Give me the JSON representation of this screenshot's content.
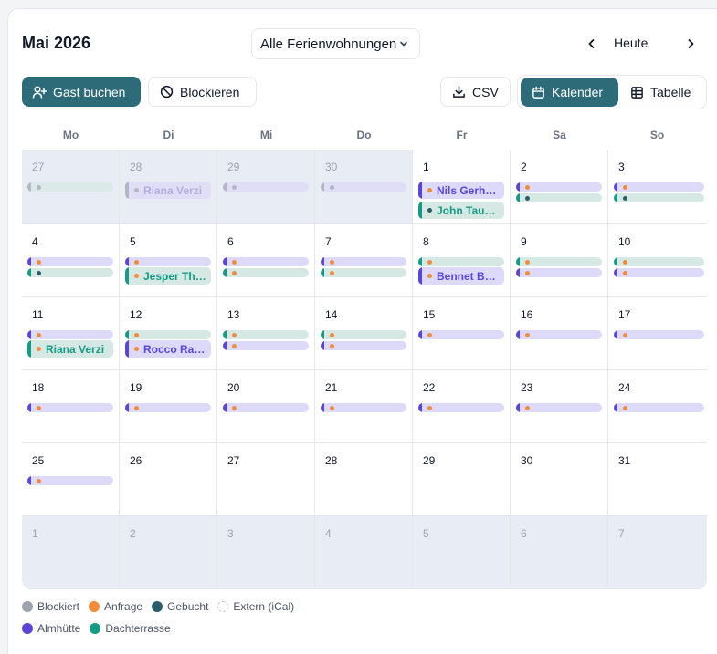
{
  "header": {
    "month_title": "Mai 2026",
    "property_select": "Alle Ferienwohnungen",
    "today_label": "Heute"
  },
  "toolbar": {
    "book_guest": "Gast buchen",
    "block": "Blockieren",
    "csv": "CSV",
    "view_calendar": "Kalender",
    "view_table": "Tabelle",
    "active_view": "Kalender"
  },
  "colors": {
    "brand": "#2d6b78",
    "almhuette": "#5b45d9",
    "dachterrasse": "#159a85",
    "blockiert": "#9ca3af",
    "anfrage": "#f28c3a",
    "gebucht": "#2c5d6b",
    "almhuette_bg": "#ddd9f8",
    "dachterrasse_bg": "#d6e8e3",
    "outside_bg": "#e8ecf5"
  },
  "weekdays": [
    "Mo",
    "Di",
    "Mi",
    "Do",
    "Fr",
    "Sa",
    "So"
  ],
  "weeks": [
    [
      {
        "day": "27",
        "outside": true,
        "events": [
          {
            "unit": "dach",
            "status": "blockiert"
          }
        ]
      },
      {
        "day": "28",
        "outside": true,
        "events": [
          {
            "unit": "alm",
            "status": "blockiert",
            "label": "Riana Verzi"
          }
        ]
      },
      {
        "day": "29",
        "outside": true,
        "events": [
          {
            "unit": "alm",
            "status": "blockiert"
          }
        ]
      },
      {
        "day": "30",
        "outside": true,
        "events": [
          {
            "unit": "alm",
            "status": "blockiert"
          }
        ]
      },
      {
        "day": "1",
        "outside": false,
        "events": [
          {
            "unit": "alm",
            "status": "anfrage",
            "label": "Nils Gerhardt"
          },
          {
            "unit": "dach",
            "status": "gebucht",
            "label": "John Tausend"
          }
        ]
      },
      {
        "day": "2",
        "outside": false,
        "events": [
          {
            "unit": "alm",
            "status": "anfrage"
          },
          {
            "unit": "dach",
            "status": "gebucht"
          }
        ]
      },
      {
        "day": "3",
        "outside": false,
        "events": [
          {
            "unit": "alm",
            "status": "anfrage"
          },
          {
            "unit": "dach",
            "status": "gebucht"
          }
        ]
      }
    ],
    [
      {
        "day": "4",
        "outside": false,
        "events": [
          {
            "unit": "alm",
            "status": "anfrage"
          },
          {
            "unit": "dach",
            "status": "gebucht"
          }
        ]
      },
      {
        "day": "5",
        "outside": false,
        "events": [
          {
            "unit": "alm",
            "status": "anfrage"
          },
          {
            "unit": "dach",
            "status": "anfrage",
            "label": "Jesper Thomsen"
          }
        ]
      },
      {
        "day": "6",
        "outside": false,
        "events": [
          {
            "unit": "alm",
            "status": "anfrage"
          },
          {
            "unit": "dach",
            "status": "anfrage"
          }
        ]
      },
      {
        "day": "7",
        "outside": false,
        "events": [
          {
            "unit": "alm",
            "status": "anfrage"
          },
          {
            "unit": "dach",
            "status": "anfrage"
          }
        ]
      },
      {
        "day": "8",
        "outside": false,
        "events": [
          {
            "unit": "dach",
            "status": "anfrage"
          },
          {
            "unit": "alm",
            "status": "anfrage",
            "label": "Bennet Bauer"
          }
        ]
      },
      {
        "day": "9",
        "outside": false,
        "events": [
          {
            "unit": "dach",
            "status": "anfrage"
          },
          {
            "unit": "alm",
            "status": "anfrage"
          }
        ]
      },
      {
        "day": "10",
        "outside": false,
        "events": [
          {
            "unit": "dach",
            "status": "anfrage"
          },
          {
            "unit": "alm",
            "status": "anfrage"
          }
        ]
      }
    ],
    [
      {
        "day": "11",
        "outside": false,
        "events": [
          {
            "unit": "alm",
            "status": "anfrage"
          },
          {
            "unit": "dach",
            "status": "anfrage",
            "label": "Riana Verzi"
          }
        ]
      },
      {
        "day": "12",
        "outside": false,
        "events": [
          {
            "unit": "dach",
            "status": "anfrage"
          },
          {
            "unit": "alm",
            "status": "anfrage",
            "label": "Rocco Rausch"
          }
        ]
      },
      {
        "day": "13",
        "outside": false,
        "events": [
          {
            "unit": "dach",
            "status": "anfrage"
          },
          {
            "unit": "alm",
            "status": "anfrage"
          }
        ]
      },
      {
        "day": "14",
        "outside": false,
        "events": [
          {
            "unit": "dach",
            "status": "anfrage"
          },
          {
            "unit": "alm",
            "status": "anfrage"
          }
        ]
      },
      {
        "day": "15",
        "outside": false,
        "events": [
          {
            "unit": "alm",
            "status": "anfrage"
          }
        ]
      },
      {
        "day": "16",
        "outside": false,
        "events": [
          {
            "unit": "alm",
            "status": "anfrage"
          }
        ]
      },
      {
        "day": "17",
        "outside": false,
        "events": [
          {
            "unit": "alm",
            "status": "anfrage"
          }
        ]
      }
    ],
    [
      {
        "day": "18",
        "outside": false,
        "events": [
          {
            "unit": "alm",
            "status": "anfrage"
          }
        ]
      },
      {
        "day": "19",
        "outside": false,
        "events": [
          {
            "unit": "alm",
            "status": "anfrage"
          }
        ]
      },
      {
        "day": "20",
        "outside": false,
        "events": [
          {
            "unit": "alm",
            "status": "anfrage"
          }
        ]
      },
      {
        "day": "21",
        "outside": false,
        "events": [
          {
            "unit": "alm",
            "status": "anfrage"
          }
        ]
      },
      {
        "day": "22",
        "outside": false,
        "events": [
          {
            "unit": "alm",
            "status": "anfrage"
          }
        ]
      },
      {
        "day": "23",
        "outside": false,
        "events": [
          {
            "unit": "alm",
            "status": "anfrage"
          }
        ]
      },
      {
        "day": "24",
        "outside": false,
        "events": [
          {
            "unit": "alm",
            "status": "anfrage"
          }
        ]
      }
    ],
    [
      {
        "day": "25",
        "outside": false,
        "events": [
          {
            "unit": "alm",
            "status": "anfrage"
          }
        ]
      },
      {
        "day": "26",
        "outside": false,
        "events": []
      },
      {
        "day": "27",
        "outside": false,
        "events": []
      },
      {
        "day": "28",
        "outside": false,
        "events": []
      },
      {
        "day": "29",
        "outside": false,
        "events": []
      },
      {
        "day": "30",
        "outside": false,
        "events": []
      },
      {
        "day": "31",
        "outside": false,
        "events": []
      }
    ],
    [
      {
        "day": "1",
        "outside": true,
        "events": []
      },
      {
        "day": "2",
        "outside": true,
        "events": []
      },
      {
        "day": "3",
        "outside": true,
        "events": []
      },
      {
        "day": "4",
        "outside": true,
        "events": []
      },
      {
        "day": "5",
        "outside": true,
        "events": []
      },
      {
        "day": "6",
        "outside": true,
        "events": []
      },
      {
        "day": "7",
        "outside": true,
        "events": []
      }
    ]
  ],
  "legend": {
    "statuses": [
      {
        "label": "Blockiert",
        "color": "#9ca3af",
        "style": "solid"
      },
      {
        "label": "Anfrage",
        "color": "#f28c3a",
        "style": "solid"
      },
      {
        "label": "Gebucht",
        "color": "#2c5d6b",
        "style": "solid"
      },
      {
        "label": "Extern (iCal)",
        "color": "#c7ccd4",
        "style": "dashed"
      }
    ],
    "units": [
      {
        "label": "Almhütte",
        "color": "#5b45d9"
      },
      {
        "label": "Dachterrasse",
        "color": "#159a85"
      }
    ]
  }
}
